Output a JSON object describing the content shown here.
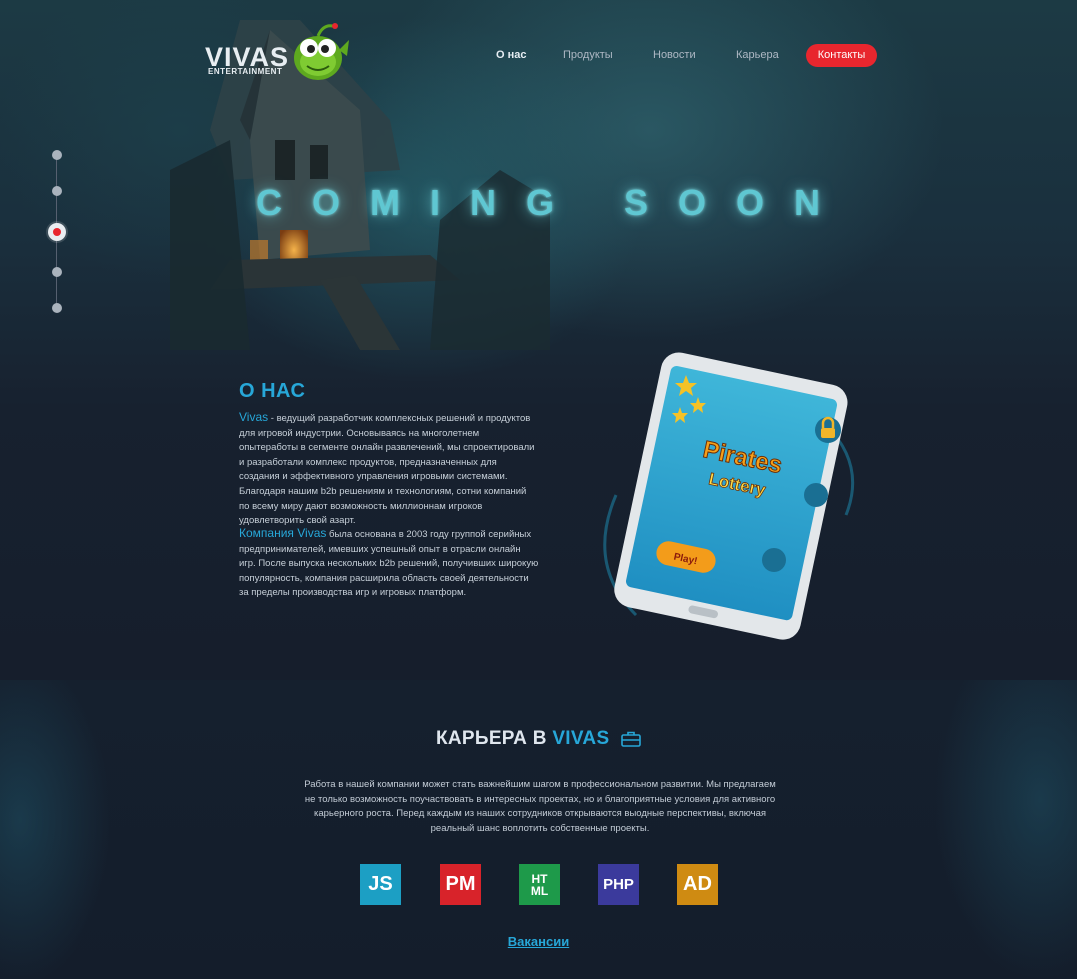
{
  "brand": {
    "logo_word": "VIVAS",
    "logo_sub": "ENTERTAINMENT"
  },
  "nav": {
    "items": [
      {
        "label": "О нас",
        "active": true
      },
      {
        "label": "Продукты",
        "active": false
      },
      {
        "label": "Новости",
        "active": false
      },
      {
        "label": "Карьера",
        "active": false
      }
    ],
    "contact_label": "Контакты"
  },
  "colors": {
    "accent": "#27a7d8",
    "red": "#e8262e",
    "glow": "#5fc7d2"
  },
  "pager": {
    "count": 5,
    "active_index": 2
  },
  "hero": {
    "headline": "COMING SOON"
  },
  "about": {
    "title": "О НАС",
    "p1_highlight": "Vivas",
    "p1_text": " - ведущий разработчик комплексных решений и продуктов для игровой индустрии. Основываясь на многолетнем опытеработы в сегменте онлайн развлечений, мы спроектировали и разработали комплекс продуктов, предназначенных для создания и эффективного управления игровыми системами. Благодаря нашим b2b решениям и технологиям, сотни компаний по всему миру дают возможность миллионнам игроков удовлетворить свой азарт.",
    "p2_highlight": "Компания Vivas",
    "p2_text": " была основана в 2003 году группой серийных предпринимателей, имевших успешный опыт в отрасли онлайн игр. После выпуска нескольких b2b решений, получивших широкую популярность, компания расширила область своей деятельности за пределы производства игр и игровых платформ."
  },
  "tablet": {
    "game_title_1": "Pirates",
    "game_title_2": "Lottery",
    "play_label": "Play!"
  },
  "career": {
    "title_prefix": "КАРЬЕРА В ",
    "title_brand": "VIVAS",
    "text": "Работа в нашей компании может стать важнейшим шагом в профессиональном развитии. Мы предлагаем не только возможность поучаствовать в интересных проектах, но и благоприятные условия для активного карьерного роста. Перед каждым из наших сотрудников открываются выодные перспективы, включая реальный шанс воплотить собственные проекты.",
    "skills": [
      {
        "label": "JS",
        "color": "#1c9fc4"
      },
      {
        "label": "PM",
        "color": "#d8232a"
      },
      {
        "label": "HT ML",
        "color": "#1e9a4a"
      },
      {
        "label": "PHP",
        "color": "#3b3a9c"
      },
      {
        "label": "AD",
        "color": "#cf8b12"
      }
    ],
    "vacancies_label": "Вакансии"
  }
}
